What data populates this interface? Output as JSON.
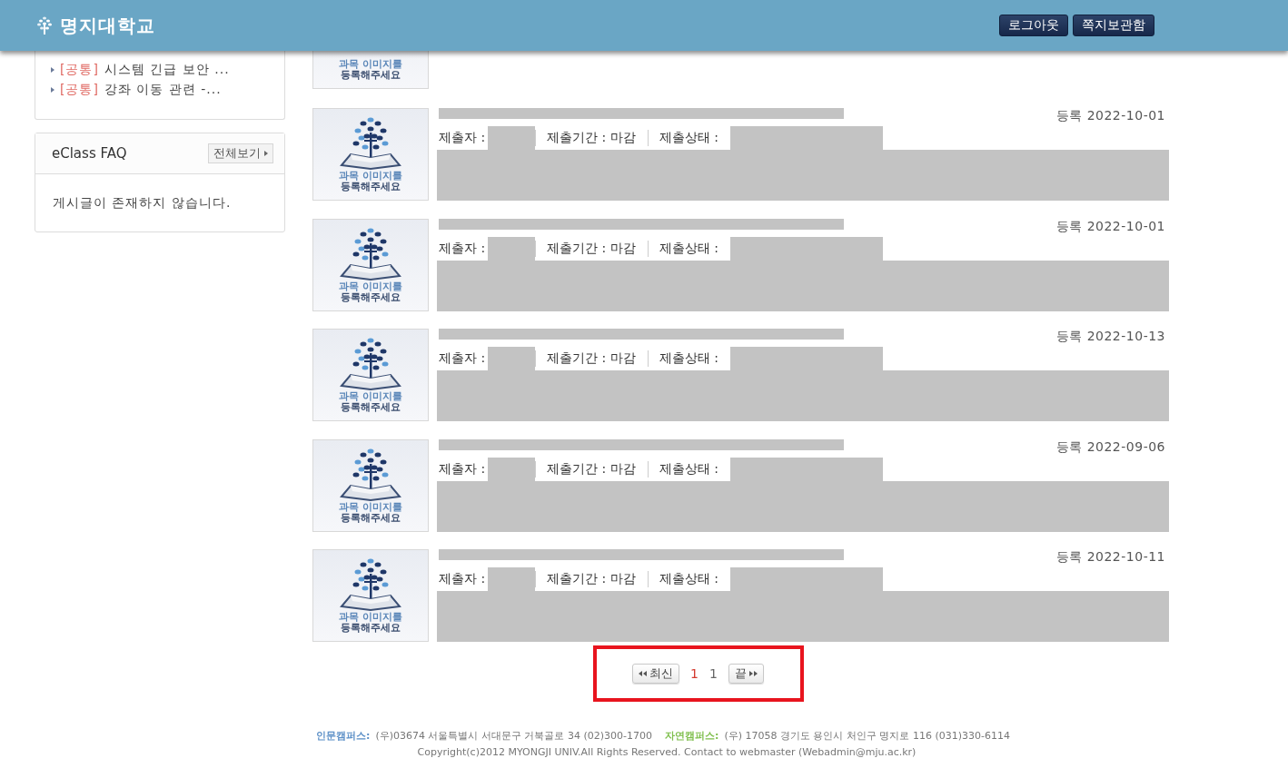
{
  "header": {
    "logo": "명지대학교",
    "buttons": [
      "로그아웃",
      "쪽지보관함"
    ]
  },
  "notices": [
    {
      "tag": "[공통]",
      "title": "시스템 긴급 보안 ..."
    },
    {
      "tag": "[공통]",
      "title": "강좌 이동 관련 -..."
    }
  ],
  "faq": {
    "title": "eClass FAQ",
    "more": "전체보기",
    "empty": "게시글이 존재하지 않습니다."
  },
  "assignments": [
    {
      "kind": "partial",
      "caption": [
        "과목 이미지를",
        "등록해주세요"
      ]
    },
    {
      "kind": "full",
      "caption": [
        "과목 이미지를",
        "등록해주세요"
      ],
      "submitter": "제출자 :",
      "period_label": "제출기간 :",
      "period": "마감",
      "status_label": "제출상태 :",
      "date": "등록 2022-10-01"
    },
    {
      "kind": "full",
      "caption": [
        "과목 이미지를",
        "등록해주세요"
      ],
      "submitter": "제출자 :",
      "period_label": "제출기간 :",
      "period": "마감",
      "status_label": "제출상태 :",
      "date": "등록 2022-10-01"
    },
    {
      "kind": "full",
      "caption": [
        "과목 이미지를",
        "등록해주세요"
      ],
      "submitter": "제출자 :",
      "period_label": "제출기간 :",
      "period": "마감",
      "status_label": "제출상태 :",
      "date": "등록 2022-10-13"
    },
    {
      "kind": "full",
      "caption": [
        "과목 이미지를",
        "등록해주세요"
      ],
      "submitter": "제출자 :",
      "period_label": "제출기간 :",
      "period": "마감",
      "status_label": "제출상태 :",
      "date": "등록 2022-09-06"
    },
    {
      "kind": "full",
      "caption": [
        "과목 이미지를",
        "등록해주세요"
      ],
      "submitter": "제출자 :",
      "period_label": "제출기간 :",
      "period": "마감",
      "status_label": "제출상태 :",
      "date": "등록 2022-10-11"
    }
  ],
  "pagination": {
    "first": "최신",
    "pages": [
      {
        "label": "1",
        "selected": true
      },
      {
        "label": "1",
        "selected": false
      }
    ],
    "last": "끝"
  },
  "footer": {
    "campuses": [
      {
        "name": "인문캠퍼스:",
        "color": "#5b8fc7",
        "address": "(우)03674   서울특별시 서대문구 거북골로 34  (02)300-1700"
      },
      {
        "name": "자연캠퍼스:",
        "color": "#7fbf4d",
        "address": "(우) 17058   경기도 용인시 처인구 명지로 116 (031)330-6114"
      }
    ],
    "copyright": "Copyright(c)2012 MYONGJI UNIV.All Rights Reserved. Contact to webmaster (Webadmin@mju.ac.kr)"
  }
}
